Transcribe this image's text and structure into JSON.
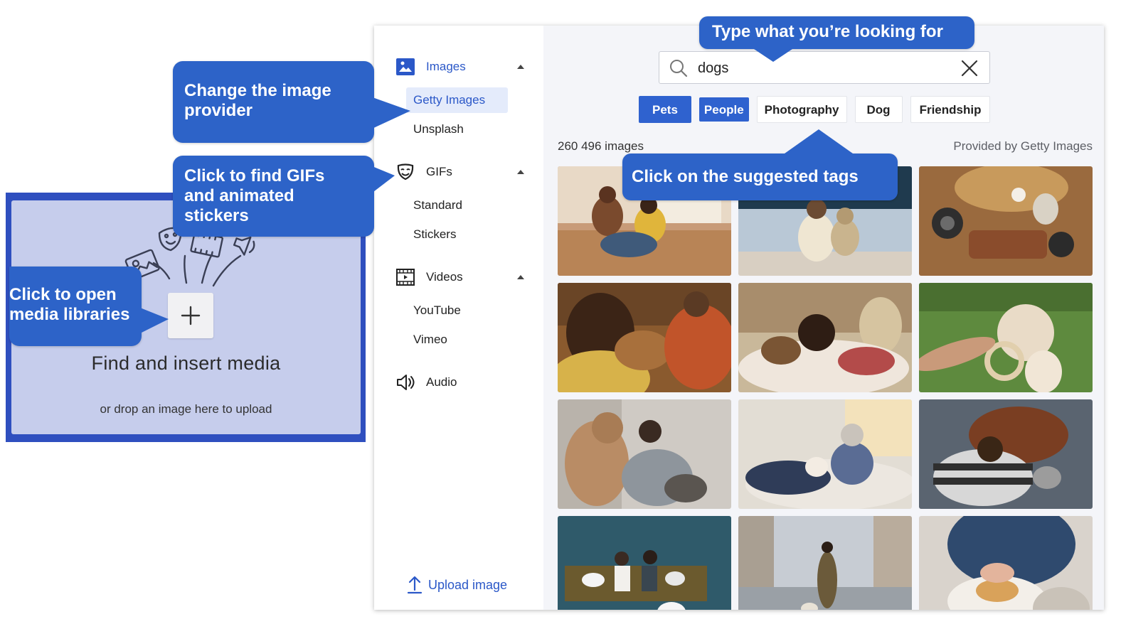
{
  "dropzone": {
    "title": "Find and insert media",
    "subtitle": "or drop an image here to upload"
  },
  "sidebar": {
    "categories": [
      {
        "label": "Images",
        "icon": "image-icon",
        "expanded": true,
        "items": [
          {
            "label": "Getty Images",
            "active": true
          },
          {
            "label": "Unsplash",
            "active": false
          }
        ]
      },
      {
        "label": "GIFs",
        "icon": "theater-mask-icon",
        "expanded": true,
        "items": [
          {
            "label": "Standard"
          },
          {
            "label": "Stickers"
          }
        ]
      },
      {
        "label": "Videos",
        "icon": "film-icon",
        "expanded": true,
        "items": [
          {
            "label": "YouTube"
          },
          {
            "label": "Vimeo"
          }
        ]
      },
      {
        "label": "Audio",
        "icon": "speaker-icon",
        "expanded": false,
        "items": []
      }
    ],
    "upload_label": "Upload image"
  },
  "search": {
    "value": "dogs",
    "placeholder": ""
  },
  "tags": [
    {
      "label": "Pets",
      "selected": true
    },
    {
      "label": "People",
      "selected": true
    },
    {
      "label": "Photography",
      "selected": false
    },
    {
      "label": "Dog",
      "selected": false
    },
    {
      "label": "Friendship",
      "selected": false
    }
  ],
  "results": {
    "count_label": "260 496 images",
    "provider_label": "Provided by Getty Images"
  },
  "callouts": {
    "search": "Type what you’re looking for",
    "provider": "Change the image provider",
    "gifs": "Click to find GIFs and  animated stickers",
    "open": "Click to open media libraries",
    "tags": "Click on the suggested tags"
  },
  "colors": {
    "accent": "#2d63c8",
    "selected_tag": "#2f62cf",
    "dropzone_bg": "#c6cdec",
    "dropzone_border": "#2f4fbf"
  }
}
